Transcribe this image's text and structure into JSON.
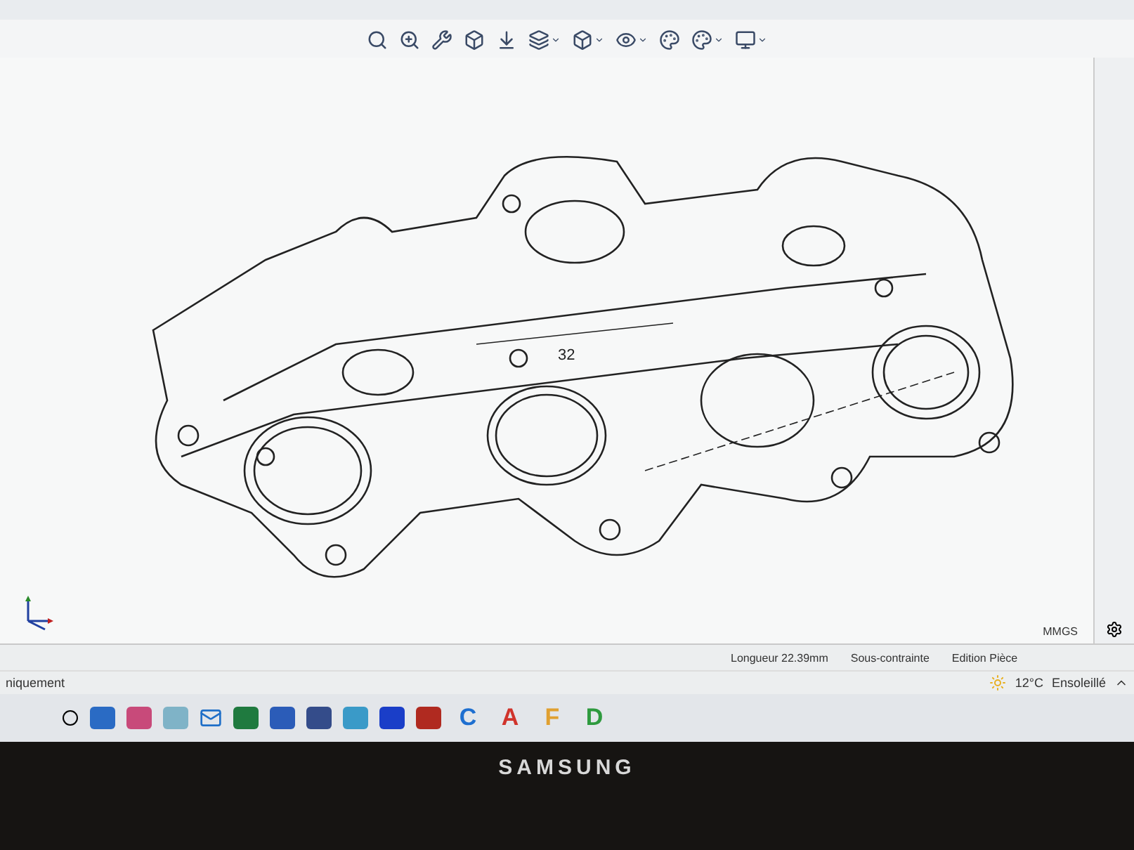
{
  "canvas": {
    "dimension": "32"
  },
  "unit_system": "MMGS",
  "status_bar": {
    "items": [
      "Longueur 22.39mm",
      "Sous-contrainte",
      "Edition Pièce"
    ]
  },
  "left_panel_text": "niquement",
  "taskbar": {
    "letter_apps": [
      {
        "letter": "C",
        "color": "#1e6fd0"
      },
      {
        "letter": "A",
        "color": "#d0342c"
      },
      {
        "letter": "F",
        "color": "#e0a030"
      },
      {
        "letter": "D",
        "color": "#2e9a3e"
      }
    ],
    "weather": {
      "temperature": "12°C",
      "condition": "Ensoleillé"
    }
  },
  "monitor": {
    "brand": "SAMSUNG"
  }
}
